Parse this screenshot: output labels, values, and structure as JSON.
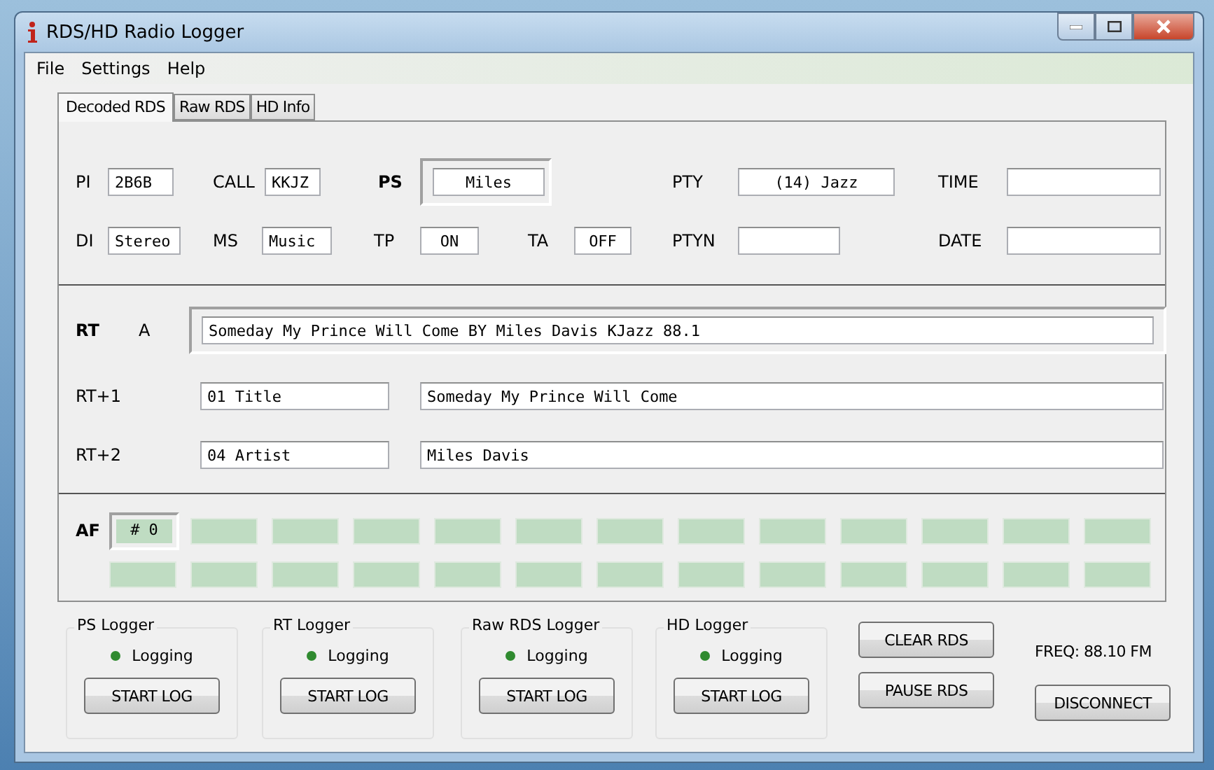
{
  "window": {
    "title": "RDS/HD Radio Logger"
  },
  "menu": [
    "File",
    "Settings",
    "Help"
  ],
  "tabs": [
    {
      "label": "Decoded RDS",
      "selected": true
    },
    {
      "label": "Raw RDS",
      "selected": false
    },
    {
      "label": "HD Info",
      "selected": false
    }
  ],
  "decoded": {
    "row_1": [
      {
        "label": "PI",
        "value": "2B6B"
      },
      {
        "label": "CALL",
        "value": "KKJZ"
      },
      {
        "label": "PS",
        "value": "Miles"
      },
      {
        "label": "PTY",
        "value": "(14) Jazz"
      },
      {
        "label": "TIME"
      }
    ],
    "row_2": [
      {
        "label": "DI",
        "value": "Stereo"
      },
      {
        "label": "MS",
        "value": "Music"
      },
      {
        "label": "TP",
        "value": "ON"
      },
      {
        "label": "TA",
        "value": "OFF"
      },
      {
        "label": "PTYN"
      },
      {
        "label": "DATE"
      }
    ]
  },
  "radiotext": {
    "label": "RT",
    "flag": "A",
    "text": "Someday My Prince Will Come BY Miles Davis KJazz 88.1",
    "plus": [
      {
        "label": "RT+1",
        "type": "01 Title",
        "text": "Someday My Prince Will Come"
      },
      {
        "label": "RT+2",
        "type": "04 Artist",
        "text": "Miles Davis"
      }
    ]
  },
  "af": {
    "label": "AF",
    "count": "# 0"
  },
  "loggers": [
    {
      "title": "PS Logger",
      "status": "Logging",
      "button": "START LOG"
    },
    {
      "title": "RT Logger",
      "status": "Logging",
      "button": "START LOG"
    },
    {
      "title": "Raw RDS Logger",
      "status": "Logging",
      "button": "START LOG"
    },
    {
      "title": "HD Logger",
      "status": "Logging",
      "button": "START LOG"
    }
  ],
  "controls": {
    "clear": "CLEAR RDS",
    "pause": "PAUSE RDS",
    "freq": "FREQ: 88.10 FM",
    "disconnect": "DISCONNECT"
  }
}
